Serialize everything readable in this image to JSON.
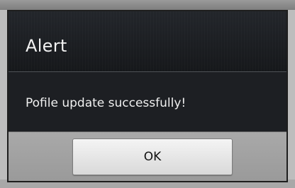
{
  "dialog": {
    "title": "Alert",
    "message": "Pofile update successfully!",
    "ok_label": "OK"
  },
  "colors": {
    "title_bg": "#1c1e22",
    "message_bg": "#1d1f23",
    "button_bar_bg": "#a1a1a1",
    "button_bg": "#e6e6e6",
    "text_light": "#f0f0f0",
    "text_dark": "#111111"
  }
}
